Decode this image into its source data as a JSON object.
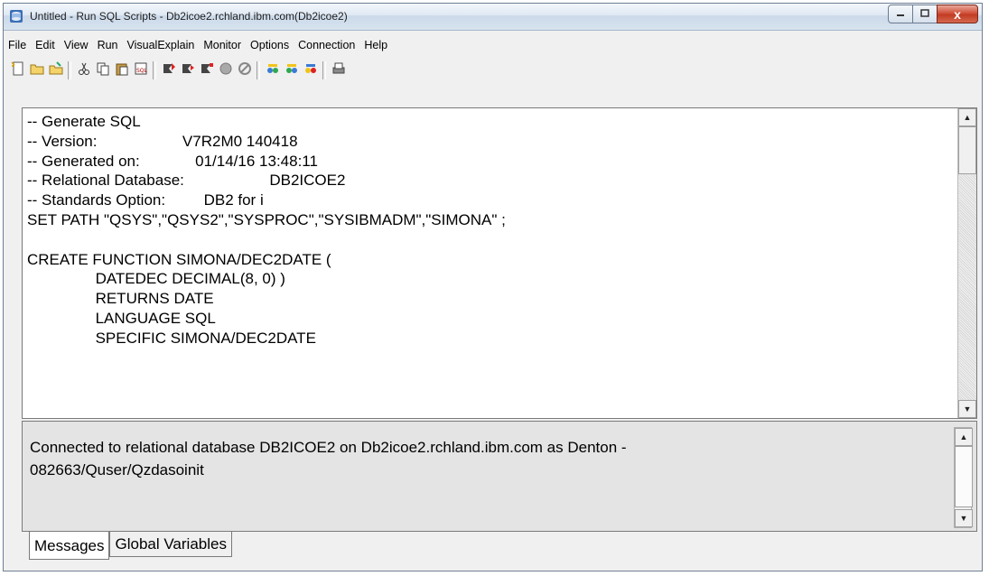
{
  "window": {
    "title": "Untitled - Run SQL Scripts - Db2icoe2.rchland.ibm.com(Db2icoe2)",
    "controls": {
      "minimize_icon": "minimize-icon",
      "maximize_icon": "maximize-icon",
      "close_label": "x"
    }
  },
  "menu": [
    "File",
    "Edit",
    "View",
    "Run",
    "VisualExplain",
    "Monitor",
    "Options",
    "Connection",
    "Help"
  ],
  "toolbar": {
    "groups": [
      [
        "new-script-icon",
        "open-icon",
        "save-icon"
      ],
      [
        "cut-icon",
        "copy-icon",
        "paste-icon",
        "insert-sql-icon"
      ],
      [
        "run-all-icon",
        "run-from-selected-icon",
        "run-selected-icon",
        "stop-icon",
        "cancel-icon"
      ],
      [
        "explain-icon",
        "run-and-explain-icon",
        "visual-explain-icon"
      ],
      [
        "print-icon"
      ]
    ]
  },
  "editor": {
    "lines": [
      "-- Generate SQL",
      "-- Version:                    V7R2M0 140418",
      "-- Generated on:             01/14/16 13:48:11",
      "-- Relational Database:                    DB2ICOE2",
      "-- Standards Option:         DB2 for i",
      "SET PATH \"QSYS\",\"QSYS2\",\"SYSPROC\",\"SYSIBMADM\",\"SIMONA\" ;",
      "",
      "CREATE FUNCTION SIMONA/DEC2DATE (",
      "                DATEDEC DECIMAL(8, 0) )",
      "                RETURNS DATE",
      "                LANGUAGE SQL",
      "                SPECIFIC SIMONA/DEC2DATE"
    ]
  },
  "messages": {
    "text_line1": "Connected to relational database DB2ICOE2 on Db2icoe2.rchland.ibm.com as Denton -",
    "text_line2": "082663/Quser/Qzdasoinit"
  },
  "tabs": [
    {
      "label": "Messages",
      "active": true
    },
    {
      "label": "Global Variables",
      "active": false
    }
  ]
}
